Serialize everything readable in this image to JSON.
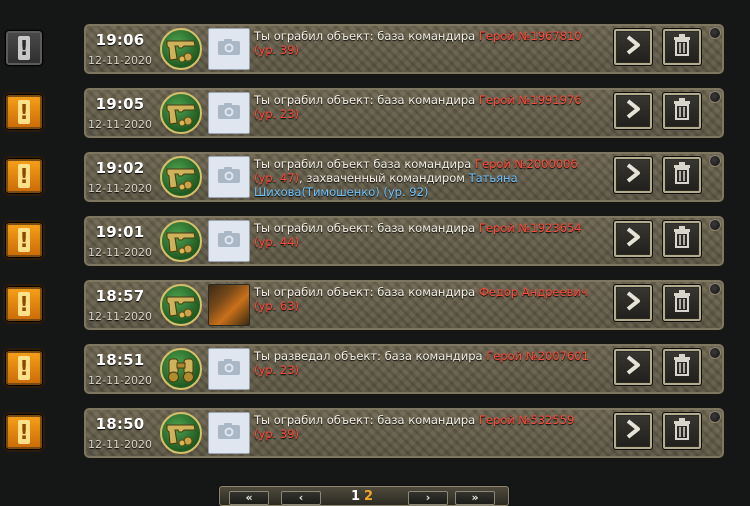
{
  "notifications": [
    {
      "read": true,
      "time": "19:06",
      "date": "12-11-2020",
      "action": "rob",
      "avatar": "placeholder",
      "text_before": "Ты ограбил объект: база командира ",
      "hero": "Герой №1967810 (ур. 39)",
      "text_mid": "",
      "commander": "",
      "text_after": ""
    },
    {
      "read": false,
      "time": "19:05",
      "date": "12-11-2020",
      "action": "rob",
      "avatar": "placeholder",
      "text_before": "Ты ограбил объект: база командира ",
      "hero": "Герой №1991976 (ур. 23)",
      "text_mid": "",
      "commander": "",
      "text_after": ""
    },
    {
      "read": false,
      "time": "19:02",
      "date": "12-11-2020",
      "action": "rob",
      "avatar": "placeholder",
      "text_before": "Ты ограбил объект база командира ",
      "hero": "Герой №2000006 (ур. 47)",
      "text_mid": ", захваченный командиром ",
      "commander": "Татьяна Шихова(Тимошенко) (ур. 92)",
      "text_after": ""
    },
    {
      "read": false,
      "time": "19:01",
      "date": "12-11-2020",
      "action": "rob",
      "avatar": "placeholder",
      "text_before": "Ты ограбил объект: база командира ",
      "hero": "Герой №1923654 (ур. 44)",
      "text_mid": "",
      "commander": "",
      "text_after": ""
    },
    {
      "read": false,
      "time": "18:57",
      "date": "12-11-2020",
      "action": "rob",
      "avatar": "photo",
      "text_before": "Ты ограбил объект: база командира ",
      "hero": "Федор Андреевич (ур. 63)",
      "text_mid": "",
      "commander": "",
      "text_after": ""
    },
    {
      "read": false,
      "time": "18:51",
      "date": "12-11-2020",
      "action": "scout",
      "avatar": "placeholder",
      "text_before": "Ты разведал объект: база командира ",
      "hero": "Герой №2007601 (ур. 23)",
      "text_mid": "",
      "commander": "",
      "text_after": ""
    },
    {
      "read": false,
      "time": "18:50",
      "date": "12-11-2020",
      "action": "rob",
      "avatar": "placeholder",
      "text_before": "Ты ограбил объект: база командира ",
      "hero": "Герой №532559 (ур. 39)",
      "text_mid": "",
      "commander": "",
      "text_after": ""
    }
  ],
  "icons": {
    "side": "exclamation-icon",
    "rob": "pistol-icon",
    "scout": "binoculars-icon",
    "avatar": "camera-icon",
    "go": "chevron-right-icon",
    "delete": "trash-icon",
    "pin": "pin-icon"
  },
  "pagination": {
    "first": "«",
    "prev": "‹",
    "pages": [
      "1",
      "2"
    ],
    "current": "1",
    "next": "›",
    "last": "»"
  },
  "colors": {
    "hero": "#ff4a3a",
    "commander": "#6fc3ff",
    "unread_badge": "#f0961a",
    "read_badge": "#3a3a3a"
  }
}
